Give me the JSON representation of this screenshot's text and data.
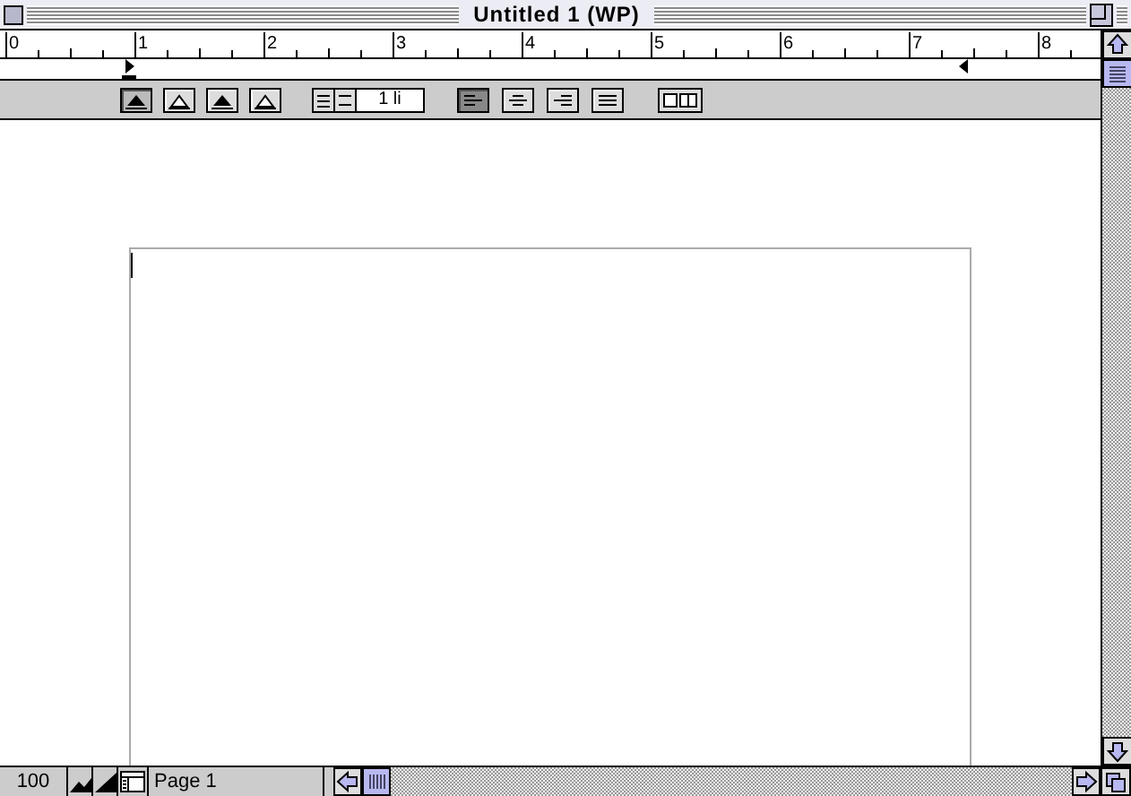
{
  "window": {
    "title": "Untitled 1 (WP)"
  },
  "ruler": {
    "labels": [
      "0",
      "1",
      "2",
      "3",
      "4",
      "5",
      "6",
      "7",
      "8"
    ]
  },
  "toolbar": {
    "indent_buttons": [
      {
        "kind": "solid",
        "selected": true
      },
      {
        "kind": "outline",
        "selected": false
      },
      {
        "kind": "solid",
        "selected": false
      },
      {
        "kind": "outline",
        "selected": false
      }
    ],
    "line_spacing": "1 li",
    "alignment_buttons": [
      {
        "kind": "left",
        "selected": true
      },
      {
        "kind": "center",
        "selected": false
      },
      {
        "kind": "right",
        "selected": false
      },
      {
        "kind": "justify",
        "selected": false
      }
    ]
  },
  "status_bar": {
    "zoom": "100",
    "page": "Page 1"
  }
}
